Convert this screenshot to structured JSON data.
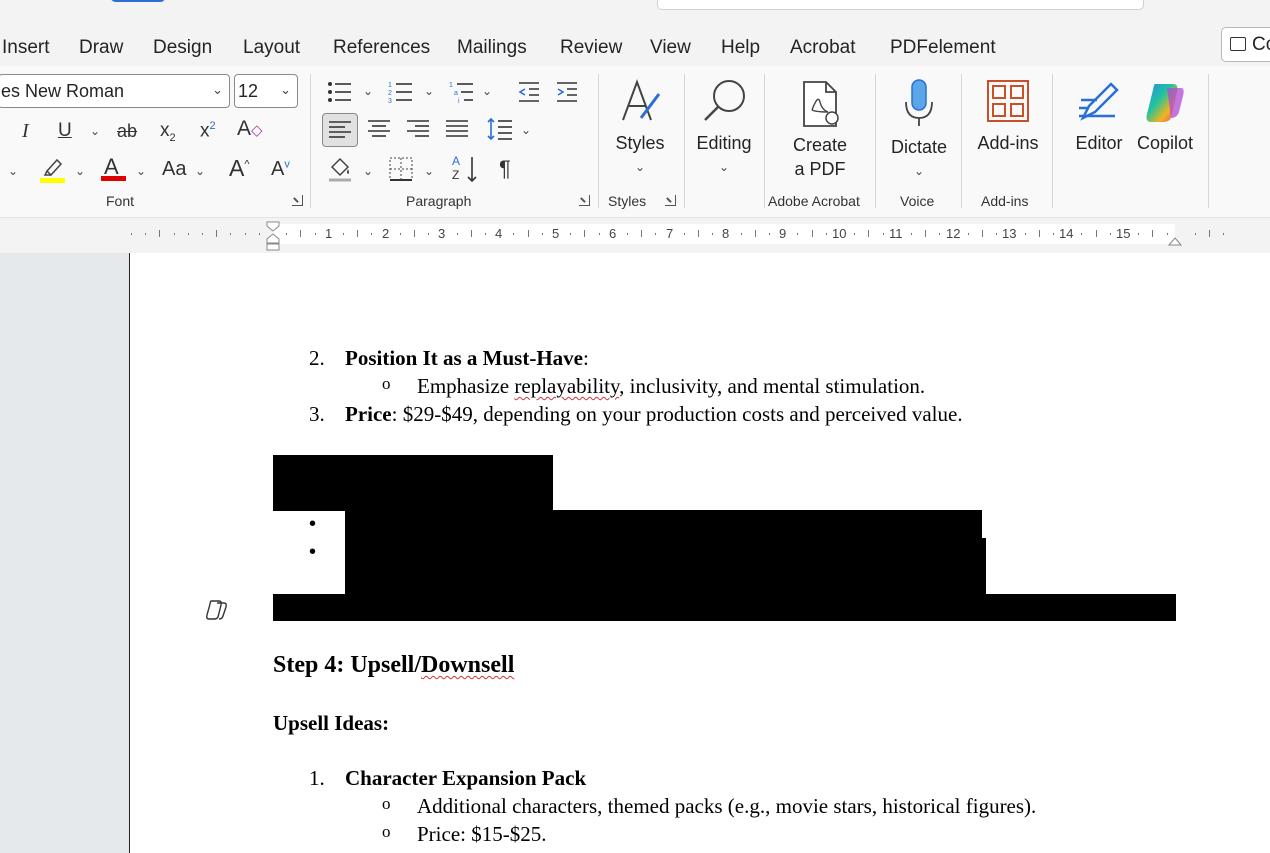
{
  "tabs": [
    "Insert",
    "Draw",
    "Design",
    "Layout",
    "References",
    "Mailings",
    "Review",
    "View",
    "Help",
    "Acrobat",
    "PDFelement"
  ],
  "comments_label": "Co",
  "font": {
    "name": "es New Roman",
    "size": "12",
    "group_label": "Font",
    "change_case": "Aa",
    "grow": "A",
    "shrink": "A"
  },
  "paragraph": {
    "group_label": "Paragraph",
    "pilcrow": "¶"
  },
  "styles": {
    "button_label": "Styles",
    "group_label": "Styles"
  },
  "editing": {
    "button_label": "Editing"
  },
  "acrobat": {
    "line1": "Create",
    "line2": "a PDF",
    "group_label": "Adobe Acrobat"
  },
  "voice": {
    "button_label": "Dictate",
    "group_label": "Voice"
  },
  "addins": {
    "button_label": "Add-ins",
    "group_label": "Add-ins"
  },
  "editor": {
    "button_label": "Editor"
  },
  "copilot": {
    "button_label": "Copilot"
  },
  "ruler": {
    "numbers": [
      "1",
      "2",
      "3",
      "4",
      "5",
      "6",
      "7",
      "8",
      "9",
      "10",
      "11",
      "12",
      "13",
      "14",
      "15"
    ]
  },
  "document": {
    "item2_num": "2.",
    "item2_bold": "Position It as a Must-Have",
    "item2_rest": ":",
    "item2_sub_bullet": "o",
    "item2_sub_pre": "Emphasize ",
    "item2_sub_squig": "replayability",
    "item2_sub_post": ", inclusivity, and mental stimulation.",
    "item3_num": "3.",
    "item3_bold": "Price",
    "item3_rest": ": $29-$49, depending on your production costs and perceived value.",
    "step4_pre": "Step 4: Upsell/",
    "step4_squig": "Downsell",
    "upsell_heading": "Upsell Ideas:",
    "upsell1_num": "1.",
    "upsell1_bold": "Character Expansion Pack",
    "upsell1_sub1_bullet": "o",
    "upsell1_sub1": "Additional characters, themed packs (e.g., movie stars, historical figures).",
    "upsell1_sub2_bullet": "o",
    "upsell1_sub2": "Price: $15-$25."
  },
  "colors": {
    "highlight": "#ffff00",
    "font_color": "#e00000",
    "accent": "#2b6fd6"
  },
  "icons": [
    "bold",
    "italic-icon",
    "underline-icon",
    "strikethrough-icon",
    "subscript-icon",
    "superscript-icon",
    "clear-formatting-icon",
    "highlighter-icon",
    "font-color-icon",
    "bullets-icon",
    "numbering-icon",
    "multilevel-icon",
    "decrease-indent-icon",
    "increase-indent-icon",
    "align-left-icon",
    "center-icon",
    "align-right-icon",
    "justify-icon",
    "line-spacing-icon",
    "shading-icon",
    "borders-icon",
    "sort-icon",
    "pilcrow-icon",
    "styles-icon",
    "search-icon",
    "pdf-icon",
    "microphone-icon",
    "addins-icon",
    "editor-pen-icon",
    "copilot-icon"
  ]
}
